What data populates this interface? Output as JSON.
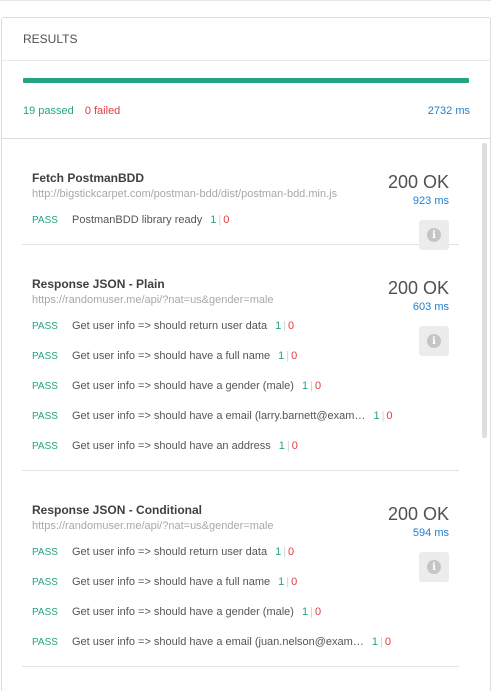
{
  "header": {
    "title": "RESULTS",
    "progress_fraction": 1.0,
    "passed_text": "19 passed",
    "failed_text": "0 failed",
    "total_time": "2732 ms"
  },
  "requests": [
    {
      "name": "Fetch PostmanBDD",
      "url": "http://bigstickcarpet.com/postman-bdd/dist/postman-bdd.min.js",
      "status": "200 OK",
      "time": "923 ms",
      "tests": [
        {
          "result": "PASS",
          "name": "PostmanBDD library ready",
          "passed": "1",
          "failed": "0"
        }
      ]
    },
    {
      "name": "Response JSON - Plain",
      "url": "https://randomuser.me/api/?nat=us&gender=male",
      "status": "200 OK",
      "time": "603 ms",
      "tests": [
        {
          "result": "PASS",
          "name": "Get user info => should return user data",
          "passed": "1",
          "failed": "0"
        },
        {
          "result": "PASS",
          "name": "Get user info => should have a full name",
          "passed": "1",
          "failed": "0"
        },
        {
          "result": "PASS",
          "name": "Get user info => should have a gender (male)",
          "passed": "1",
          "failed": "0"
        },
        {
          "result": "PASS",
          "name": "Get user info => should have a email (larry.barnett@exam…",
          "passed": "1",
          "failed": "0"
        },
        {
          "result": "PASS",
          "name": "Get user info => should have an address",
          "passed": "1",
          "failed": "0"
        }
      ]
    },
    {
      "name": "Response JSON - Conditional",
      "url": "https://randomuser.me/api/?nat=us&gender=male",
      "status": "200 OK",
      "time": "594 ms",
      "tests": [
        {
          "result": "PASS",
          "name": "Get user info => should return user data",
          "passed": "1",
          "failed": "0"
        },
        {
          "result": "PASS",
          "name": "Get user info => should have a full name",
          "passed": "1",
          "failed": "0"
        },
        {
          "result": "PASS",
          "name": "Get user info => should have a gender (male)",
          "passed": "1",
          "failed": "0"
        },
        {
          "result": "PASS",
          "name": "Get user info => should have a email (juan.nelson@exam…",
          "passed": "1",
          "failed": "0"
        }
      ]
    }
  ],
  "icons": {
    "info": "info-icon"
  },
  "colors": {
    "pass": "#26a383",
    "fail": "#e33c3c",
    "link": "#1f7fcf"
  }
}
